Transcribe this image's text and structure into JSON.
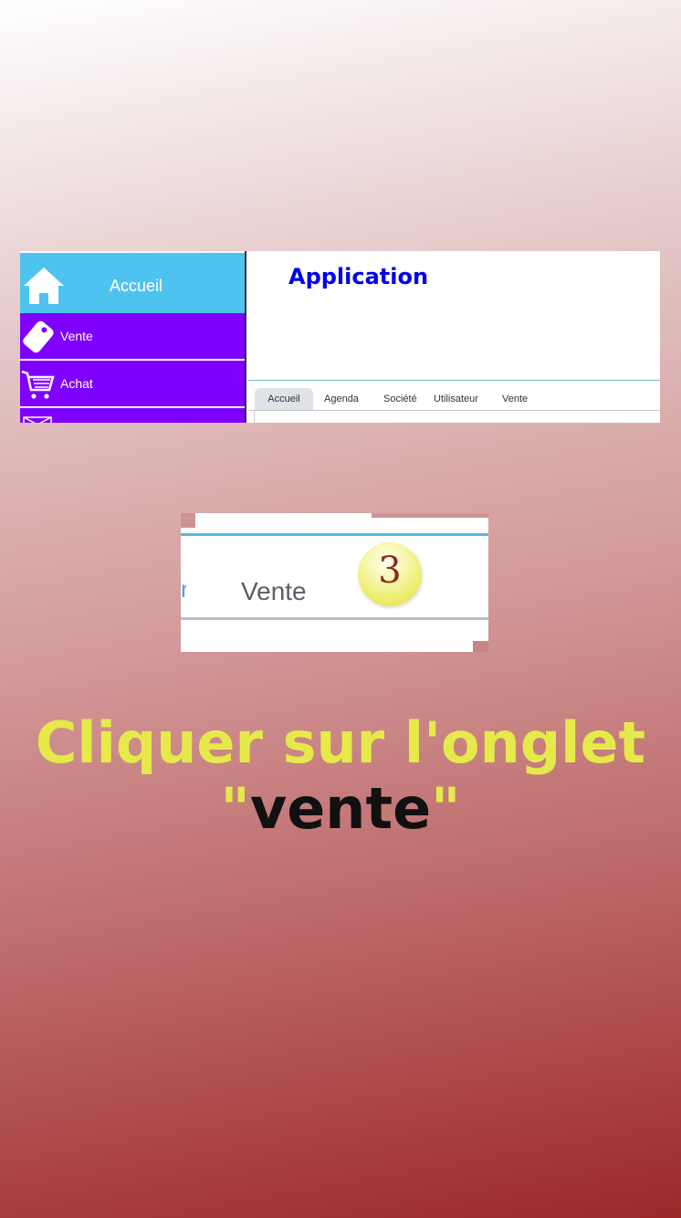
{
  "screenshot": {
    "sidebar": {
      "home_label": "Accueil",
      "items": [
        {
          "label": "Vente",
          "icon": "tag-icon"
        },
        {
          "label": "Achat",
          "icon": "cart-icon"
        },
        {
          "label": "",
          "icon": "envelope-icon"
        }
      ]
    },
    "app_title": "Application",
    "tabs": [
      {
        "label": "Accueil",
        "active": true
      },
      {
        "label": "Agenda",
        "active": false
      },
      {
        "label": "Société",
        "active": false
      },
      {
        "label": "Utilisateur",
        "active": false
      },
      {
        "label": "Vente",
        "active": false
      }
    ],
    "colors": {
      "home_tile": "#4fc3f0",
      "nav_item": "#8000ff",
      "app_title": "#0000ee",
      "caption_yellow": "#e5ea4a"
    }
  },
  "zoom": {
    "tab_label": "Vente",
    "fragment": "r",
    "step_number": "3"
  },
  "caption": {
    "line1": "Cliquer sur l'onglet",
    "quote_open": "\"",
    "word": "vente",
    "quote_close": "\""
  }
}
